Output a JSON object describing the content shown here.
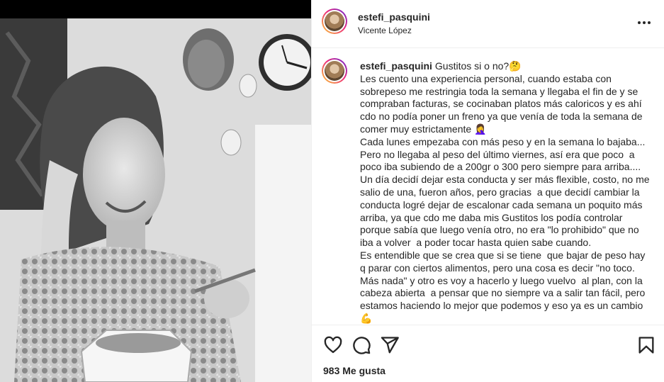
{
  "post": {
    "username": "estefi_pasquini",
    "location": "Vicente López",
    "caption_title": "Gustitos si o no?🤔",
    "caption_body": "Les cuento una experiencia personal, cuando estaba con sobrepeso me restringia toda la semana y llegaba el fin de y se compraban facturas, se cocinaban platos más caloricos y es ahí cdo no podía poner un freno ya que venía de toda la semana de comer muy estrictamente 🤦‍♀️\nCada lunes empezaba con más peso y en la semana lo bajaba... Pero no llegaba al peso del último viernes, así era que poco  a poco iba subiendo de a 200gr o 300 pero siempre para arriba.... Un día decidí dejar esta conducta y ser más flexible, costo, no me salio de una, fueron años, pero gracias  a que decidí cambiar la conducta logré dejar de escalonar cada semana un poquito más arriba, ya que cdo me daba mis Gustitos los podía controlar porque sabía que luego venía otro, no era \"lo prohibido\" que no iba a volver  a poder tocar hasta quien sabe cuando.\nEs entendible que se crea que si se tiene  que bajar de peso hay q parar con ciertos alimentos, pero una cosa es decir \"no toco. Más nada\" y otro es voy a hacerlo y luego vuelvo  al plan, con la cabeza abierta  a pensar que no siempre va a salir tan fácil, pero estamos haciendo lo mejor que podemos y eso ya es un cambio 💪",
    "likes": "983 Me gusta"
  },
  "icons": {
    "more": "more-options-icon",
    "like": "heart-icon",
    "comment": "comment-icon",
    "share": "share-icon",
    "save": "bookmark-icon"
  },
  "colors": {
    "text": "#262626",
    "story_ring_start": "#f9ce34",
    "story_ring_mid": "#ee2a7b",
    "story_ring_end": "#6228d7"
  }
}
